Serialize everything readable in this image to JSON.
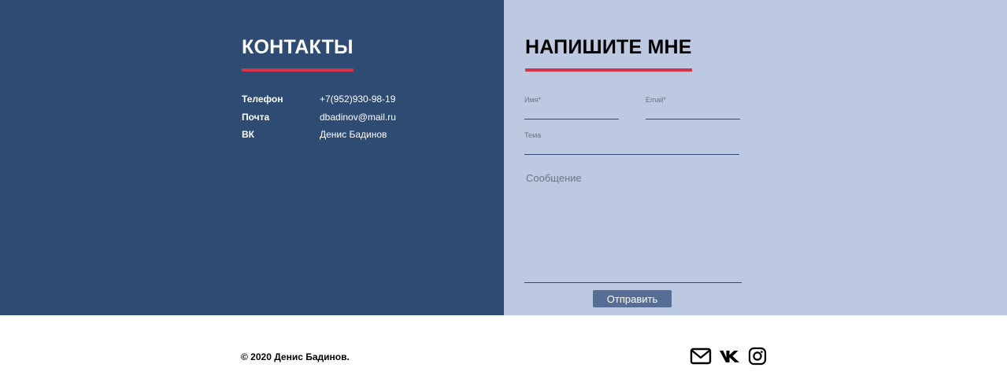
{
  "contacts": {
    "title": "КОНТАКТЫ",
    "rows": [
      {
        "label": "Телефон",
        "value": "+7(952)930-98-19"
      },
      {
        "label": "Почта",
        "value": "dbadinov@mail.ru"
      },
      {
        "label": "ВК",
        "value": "Денис Бадинов"
      }
    ]
  },
  "form": {
    "title": "НАПИШИТЕ МНЕ",
    "name_placeholder": "Имя*",
    "email_placeholder": "Email*",
    "subject_placeholder": "Тема",
    "message_placeholder": "Сообщение",
    "submit_label": "Отправить"
  },
  "footer": {
    "copyright": "© 2020 Денис Бадинов.",
    "social": [
      "envelope-icon",
      "vk-icon",
      "instagram-icon"
    ]
  },
  "colors": {
    "left_panel": "#2e4b74",
    "right_panel": "#bdc9e0",
    "accent": "#d9334a",
    "button": "#566e96"
  }
}
